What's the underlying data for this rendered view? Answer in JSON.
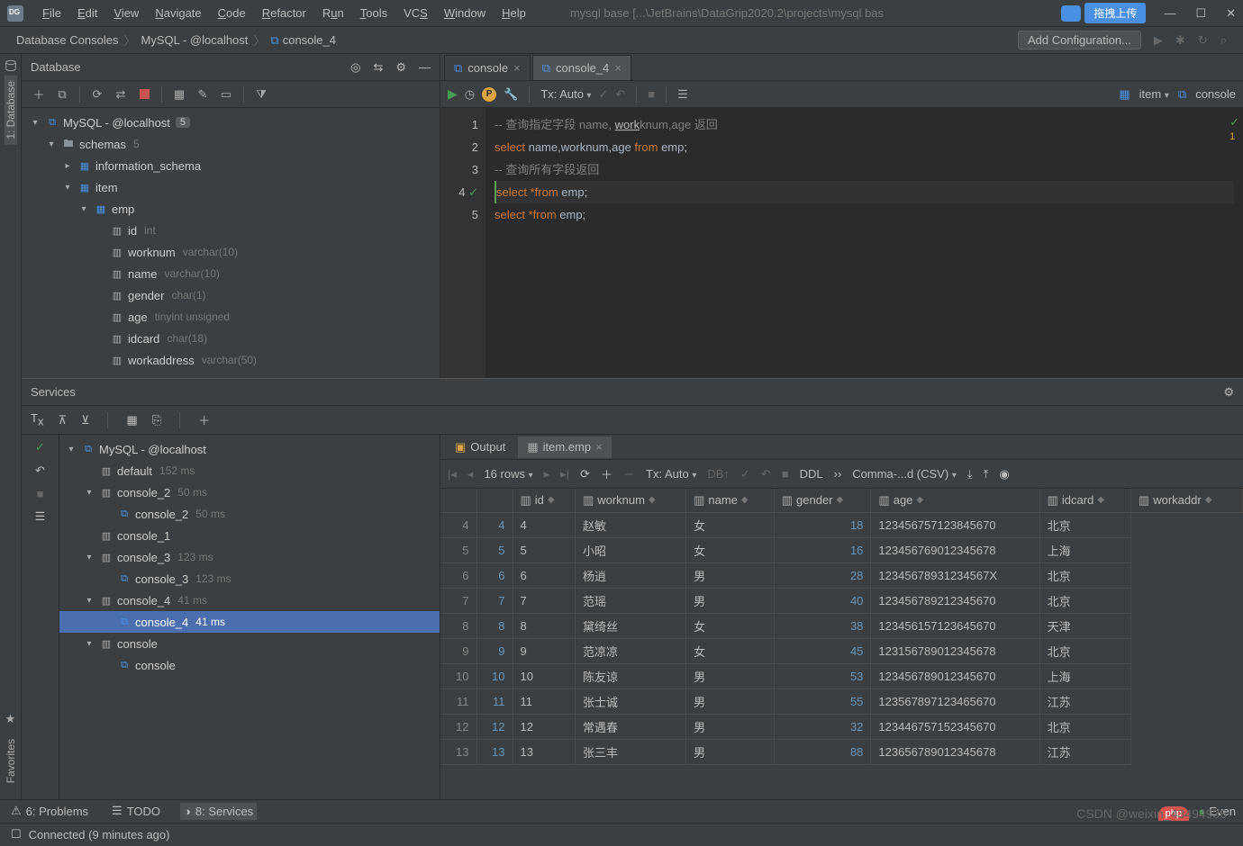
{
  "menu": [
    "File",
    "Edit",
    "View",
    "Navigate",
    "Code",
    "Refactor",
    "Run",
    "Tools",
    "VCS",
    "Window",
    "Help"
  ],
  "menu_accel": [
    "F",
    "E",
    "V",
    "N",
    "C",
    "R",
    "u",
    "T",
    "S",
    "W",
    "H"
  ],
  "title_path": "mysql base [...\\JetBrains\\DataGrip2020.2\\projects\\mysql bas",
  "blue_btn": "拖拽上传",
  "breadcrumb": [
    "Database Consoles",
    "MySQL - @localhost",
    "console_4"
  ],
  "add_config": "Add Configuration...",
  "db_panel_title": "Database",
  "left_rail": {
    "label": "1: Database",
    "fav": "Favorites"
  },
  "tree": {
    "root": {
      "label": "MySQL - @localhost",
      "badge": "5"
    },
    "schemas": {
      "label": "schemas",
      "badge": "5"
    },
    "info_schema": "information_schema",
    "item": "item",
    "emp": "emp",
    "cols": [
      {
        "name": "id",
        "type": "int"
      },
      {
        "name": "worknum",
        "type": "varchar(10)"
      },
      {
        "name": "name",
        "type": "varchar(10)"
      },
      {
        "name": "gender",
        "type": "char(1)"
      },
      {
        "name": "age",
        "type": "tinyint unsigned"
      },
      {
        "name": "idcard",
        "type": "char(18)"
      },
      {
        "name": "workaddress",
        "type": "varchar(50)"
      }
    ]
  },
  "editor_tabs": [
    "console",
    "console_4"
  ],
  "tx_label": "Tx: Auto",
  "item_label": "item",
  "console_label": "console",
  "code_lines": [
    {
      "n": "1",
      "t": "-- 查询指定字段 name, worknum,age 返回",
      "cmt": true
    },
    {
      "n": "2",
      "t": "select name,worknum,age from emp;"
    },
    {
      "n": "3",
      "t": "-- 查询所有字段返回",
      "cmt": true
    },
    {
      "n": "4",
      "t": "select *from emp;",
      "hl": true,
      "chk": true
    },
    {
      "n": "5",
      "t": "select *from emp;"
    }
  ],
  "err_count": "1",
  "services_title": "Services",
  "svc_tree": [
    {
      "d": 0,
      "exp": "v",
      "label": "MySQL - @localhost",
      "icon": "db"
    },
    {
      "d": 1,
      "exp": "",
      "label": "default",
      "ms": "152 ms",
      "icon": "con"
    },
    {
      "d": 1,
      "exp": "v",
      "label": "console_2",
      "ms": "50 ms",
      "icon": "con"
    },
    {
      "d": 2,
      "exp": "",
      "label": "console_2",
      "ms": "50 ms",
      "icon": "sql"
    },
    {
      "d": 1,
      "exp": "",
      "label": "console_1",
      "icon": "con"
    },
    {
      "d": 1,
      "exp": "v",
      "label": "console_3",
      "ms": "123 ms",
      "icon": "con"
    },
    {
      "d": 2,
      "exp": "",
      "label": "console_3",
      "ms": "123 ms",
      "icon": "sql"
    },
    {
      "d": 1,
      "exp": "v",
      "label": "console_4",
      "ms": "41 ms",
      "icon": "con"
    },
    {
      "d": 2,
      "exp": "",
      "label": "console_4",
      "ms": "41 ms",
      "icon": "sql",
      "sel": true
    },
    {
      "d": 1,
      "exp": "v",
      "label": "console",
      "icon": "con"
    },
    {
      "d": 2,
      "exp": "",
      "label": "console",
      "icon": "sql"
    }
  ],
  "output_tab": "Output",
  "item_emp_tab": "item.emp",
  "rows_label": "16 rows",
  "tx_auto": "Tx: Auto",
  "ddl": "DDL",
  "csv": "Comma-...d (CSV)",
  "grid_cols": [
    "id",
    "worknum",
    "name",
    "gender",
    "age",
    "idcard",
    "workaddr"
  ],
  "grid_rows": [
    {
      "n": "4",
      "id": "4",
      "wk": "4",
      "nm": "赵敏",
      "g": "女",
      "age": "18",
      "ic": "123456757123845670",
      "wa": "北京"
    },
    {
      "n": "5",
      "id": "5",
      "wk": "5",
      "nm": "小昭",
      "g": "女",
      "age": "16",
      "ic": "123456769012345678",
      "wa": "上海"
    },
    {
      "n": "6",
      "id": "6",
      "wk": "6",
      "nm": "杨逍",
      "g": "男",
      "age": "28",
      "ic": "12345678931234567X",
      "wa": "北京"
    },
    {
      "n": "7",
      "id": "7",
      "wk": "7",
      "nm": "范瑶",
      "g": "男",
      "age": "40",
      "ic": "123456789212345670",
      "wa": "北京"
    },
    {
      "n": "8",
      "id": "8",
      "wk": "8",
      "nm": "黛绮丝",
      "g": "女",
      "age": "38",
      "ic": "123456157123645670",
      "wa": "天津"
    },
    {
      "n": "9",
      "id": "9",
      "wk": "9",
      "nm": "范凉凉",
      "g": "女",
      "age": "45",
      "ic": "123156789012345678",
      "wa": "北京"
    },
    {
      "n": "10",
      "id": "10",
      "wk": "10",
      "nm": "陈友谅",
      "g": "男",
      "age": "53",
      "ic": "123456789012345670",
      "wa": "上海"
    },
    {
      "n": "11",
      "id": "11",
      "wk": "11",
      "nm": "张士诚",
      "g": "男",
      "age": "55",
      "ic": "123567897123465670",
      "wa": "江苏"
    },
    {
      "n": "12",
      "id": "12",
      "wk": "12",
      "nm": "常遇春",
      "g": "男",
      "age": "32",
      "ic": "123446757152345670",
      "wa": "北京"
    },
    {
      "n": "13",
      "id": "13",
      "wk": "13",
      "nm": "张三丰",
      "g": "男",
      "age": "88",
      "ic": "123656789012345678",
      "wa": "江苏"
    }
  ],
  "status_tabs": {
    "problems": "6: Problems",
    "todo": "TODO",
    "services": "8: Services"
  },
  "status_msg": "Connected (9 minutes ago)",
  "watermark": "CSDN @weixin_43494936",
  "php": "php",
  "event": "Even"
}
